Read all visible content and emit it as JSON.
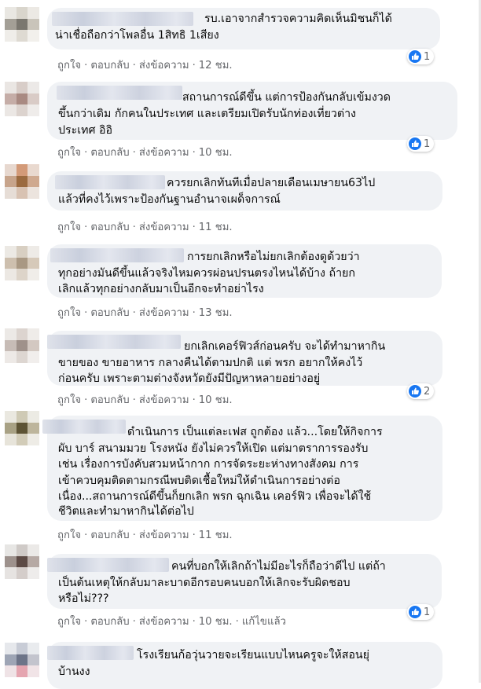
{
  "labels": {
    "like": "ถูกใจ",
    "reply": "ตอบกลับ",
    "message": "ส่งข้อความ",
    "edited": "แก้ไขแล้ว"
  },
  "colors": {
    "bubble": "#f0f2f5",
    "meta_text": "#65676b",
    "like_blue": "#1877f2"
  },
  "comments": [
    {
      "lines": [
        "รบ.เอาจากสำรวจความคิดเห็นมิชนก็ได้",
        "น่าเชื่อถือกว่าโพลอื่น 1สิทธิ 1เสียง"
      ],
      "time": "12 ชม.",
      "reactions": "1",
      "reaction_icon": "like-icon"
    },
    {
      "lines": [
        "สถานการณ์ดีขึ้น แต่การป้องกันกลับเข้มงวด",
        "ขึ้นกว่าเดิม กักคนในประเทศ และเตรียมเปิดรับนักท่องเที่ยวต่าง",
        "ประเทศ อิอิ"
      ],
      "time": "10 ชม.",
      "reactions": "1",
      "reaction_icon": "like-icon"
    },
    {
      "lines": [
        "ควรยกเลิกทันทีเมื่อปลายเดือนเมษายน63ไป",
        "แล้วที่คงไว้เพราะป้องกันฐานอำนาจเผด็จการณ์"
      ],
      "time": "11 ชม."
    },
    {
      "lines": [
        "การยกเลิกหรือไม่ยกเลิกต้องดูด้วยว่า",
        "ทุกอย่างมันดีขึ้นแล้วจริงไหมควรผ่อนปรนตรงไหนได้บ้าง ถ้ายก",
        "เลิกแล้วทุกอย่างกลับมาเป็นอีกจะทำอย่าไรง"
      ],
      "time": "13 ชม."
    },
    {
      "lines": [
        "ยกเลิกเคอร์ฟิวส์ก่อนครับ จะได้ทำมาหากิน",
        "ขายของ ขายอาหาร กลางคืนได้ตามปกติ แต่ พรก อยากให้คงไว้",
        "ก่อนครับ เพราะตามต่างจังหวัดยังมีปัญหาหลายอย่างอยู่"
      ],
      "time": "10 ชม.",
      "reactions": "2",
      "reaction_icon": "like-icon"
    },
    {
      "lines": [
        "ดำเนินการ เป็นแต่ละเฟส ถูกต้อง แล้ว...โดยให้กิจการ",
        "ผับ บาร์ สนามมวย โรงหนัง ยังไม่ควรให้เปิด แต่มาตราการรองรับ",
        "เช่น เรื่องการบังคับสวมหน้ากาก การจัดระยะห่างทางสังคม การ",
        "เข้าควบคุมติดตามกรณีพบติดเชื้อใหม่ให้ดำเนินการอย่างต่อ",
        "เนื่อง...สถานการณ์ดีขึ้นก็ยกเลิก พรก ฉุกเฉิน เคอร์ฟิว เพื่อจะได้ใช้",
        "ชีวิตและทำมาหากินได้ต่อไป"
      ],
      "time": "11 ชม."
    },
    {
      "lines": [
        "คนที่บอกให้เลิกถ้าไม่มีอะไรก็ถือว่าดีไป แต่ถ้า",
        "เป็นต้นเหตุให้กลับมาละบาดอีกรอบคนบอกให้เลิกจะรับผิดชอบ",
        "หรือไม่???"
      ],
      "time": "10 ชม.",
      "edited": true,
      "reactions": "1",
      "reaction_icon": "like-icon"
    },
    {
      "lines": [
        "โรงเรียนก้อวุ่นวายจะเรียนแบบไหนครูจะให้สอนยุ่",
        "บ้านงง"
      ]
    }
  ]
}
